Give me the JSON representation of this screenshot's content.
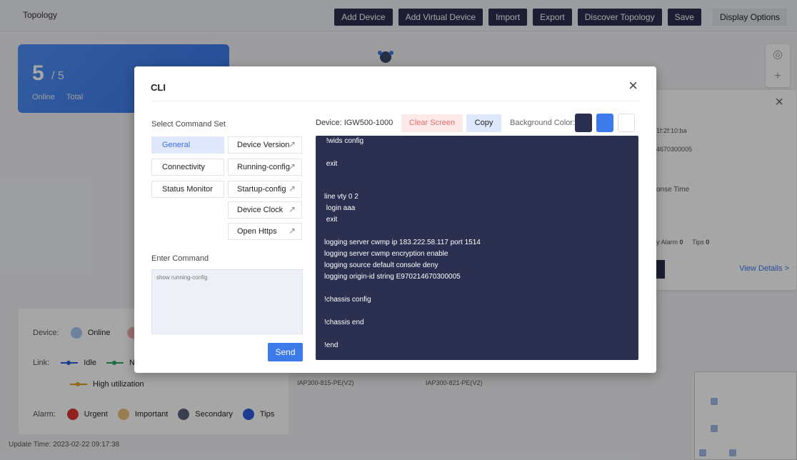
{
  "topbar": {
    "title": "Topology",
    "buttons": [
      "Add Device",
      "Add Virtual Device",
      "Import",
      "Export",
      "Discover Topology",
      "Save"
    ],
    "display_options": "Display Options"
  },
  "stats": {
    "online_count": "5",
    "total_count": "/ 5",
    "online_label": "Online",
    "total_label": "Total"
  },
  "detail_panel": {
    "mac_fragment": "1f:2f:10:ba",
    "serial_fragment": "4670300005",
    "response_time": "onse Time",
    "alarm_label": "y Alarm",
    "alarm_count": "0",
    "tips_label": "Tips",
    "tips_count": "0",
    "view_details": "View Details >"
  },
  "legend": {
    "device_label": "Device:",
    "online": "Online",
    "link_label": "Link:",
    "idle": "Idle",
    "n_fragment": "N",
    "high_util": "High utilization",
    "alarm_label": "Alarm:",
    "urgent": "Urgent",
    "important": "Important",
    "secondary": "Secondary",
    "tips": "Tips",
    "colors": {
      "online": "#a9c6f2",
      "urgent": "#e03434",
      "important": "#e9c07c",
      "secondary": "#5b6076",
      "tips": "#2f5fe0",
      "idle_link": "#2f5fe0",
      "n_link": "#2aa86a",
      "high_link": "#e0a020"
    }
  },
  "device_labels": [
    "IAP300-815-PE(V2)",
    "IAP300-821-PE(V2)"
  ],
  "update_time": "Update Time: 2023-02-22 09:17:38",
  "modal": {
    "title": "CLI",
    "close": "×",
    "select_command_set": "Select Command Set",
    "command_sets": [
      "General",
      "Connectivity",
      "Status Monitor"
    ],
    "selected_set": "General",
    "commands": [
      "Device Version",
      "Running-config",
      "Startup-config",
      "Device Clock",
      "Open Https"
    ],
    "enter_command": "Enter Command",
    "input_placeholder": "show running-config",
    "send": "Send",
    "device": "Device: IGW500-1000",
    "clear_screen": "Clear Screen",
    "copy": "Copy",
    "background_color": "Background Color:",
    "swatch_colors": [
      "#2b3050",
      "#3b7ae8",
      "#ffffff"
    ],
    "terminal_lines": [
      " !wids config",
      " exit",
      "line vty 0 2",
      " login aaa",
      " exit",
      "logging server cwmp ip 183.222.58.117 port 1514",
      "logging server cwmp encryption enable",
      "logging source default console deny",
      "logging origin-id string E970214670300005",
      "!chassis config",
      "!chassis end",
      "!end"
    ]
  }
}
